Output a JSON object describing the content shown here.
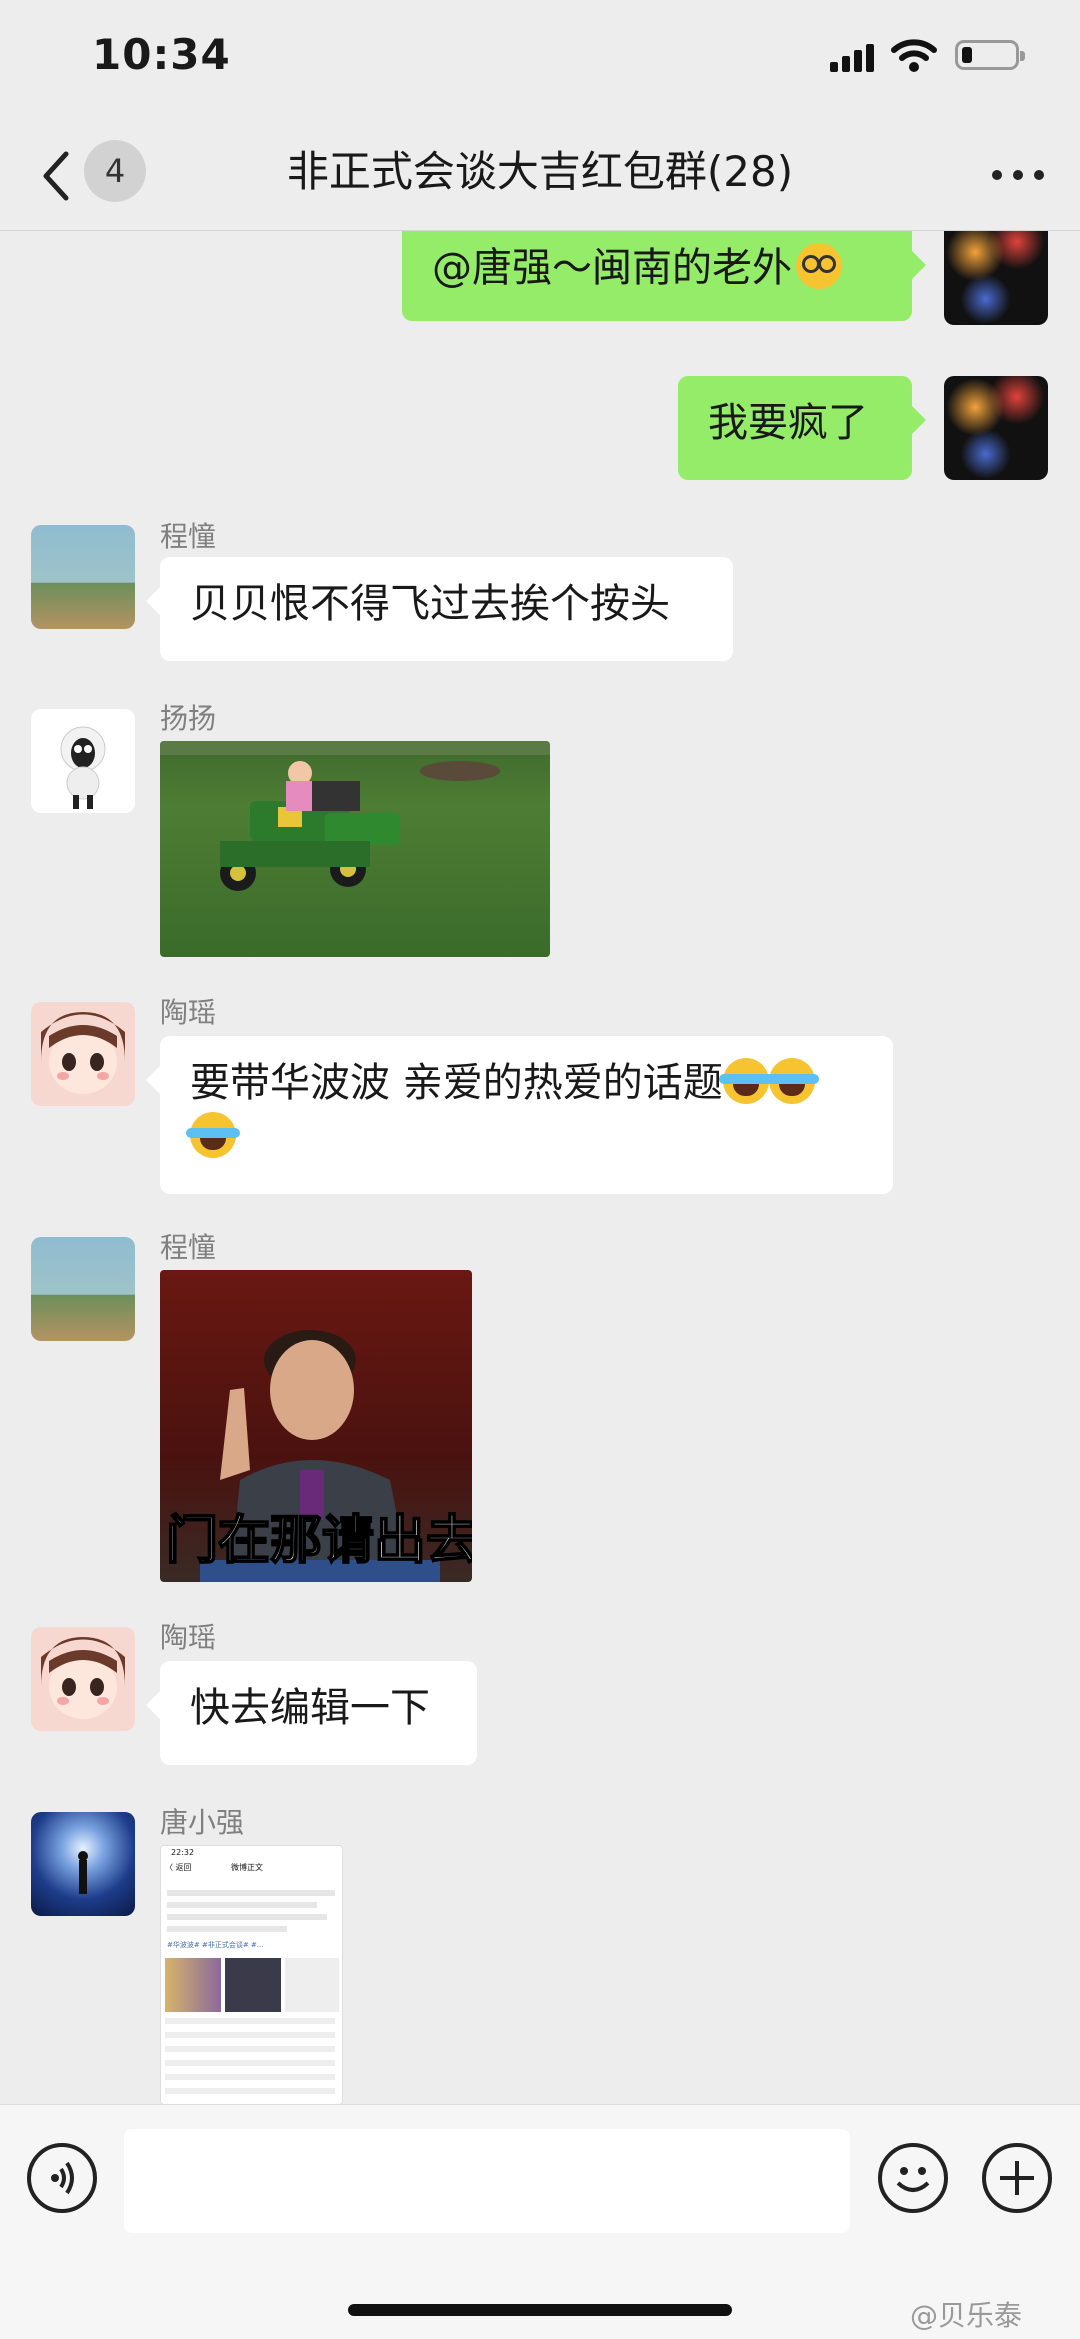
{
  "status_bar": {
    "time": "10:34",
    "battery_level": 0.2
  },
  "nav": {
    "unread_count": "4",
    "title": "非正式会谈大吉红包群(28)"
  },
  "messages": [
    {
      "sender": "me",
      "text": "@唐强～闽南的老外"
    },
    {
      "sender": "me",
      "text": "我要疯了"
    },
    {
      "sender_name": "程憧",
      "text": "贝贝恨不得飞过去挨个按头"
    },
    {
      "sender_name": "扬扬",
      "type": "image"
    },
    {
      "sender_name": "陶瑶",
      "text": "要带华波波 亲爱的热爱的话题"
    },
    {
      "sender_name": "程憧",
      "type": "image",
      "caption_in_image": "门在那请出去"
    },
    {
      "sender_name": "陶瑶",
      "text": "快去编辑一下"
    },
    {
      "sender_name": "唐小强",
      "type": "image"
    }
  ],
  "screenshot_thumb": {
    "time": "22:32",
    "back": "〈 返回",
    "title": "微博正文",
    "tags": "#华波波# #非正式会谈# #..."
  },
  "watermark": "@贝乐泰",
  "colors": {
    "bubble_me": "#95ec69",
    "bubble_them": "#ffffff",
    "background": "#ededed"
  }
}
